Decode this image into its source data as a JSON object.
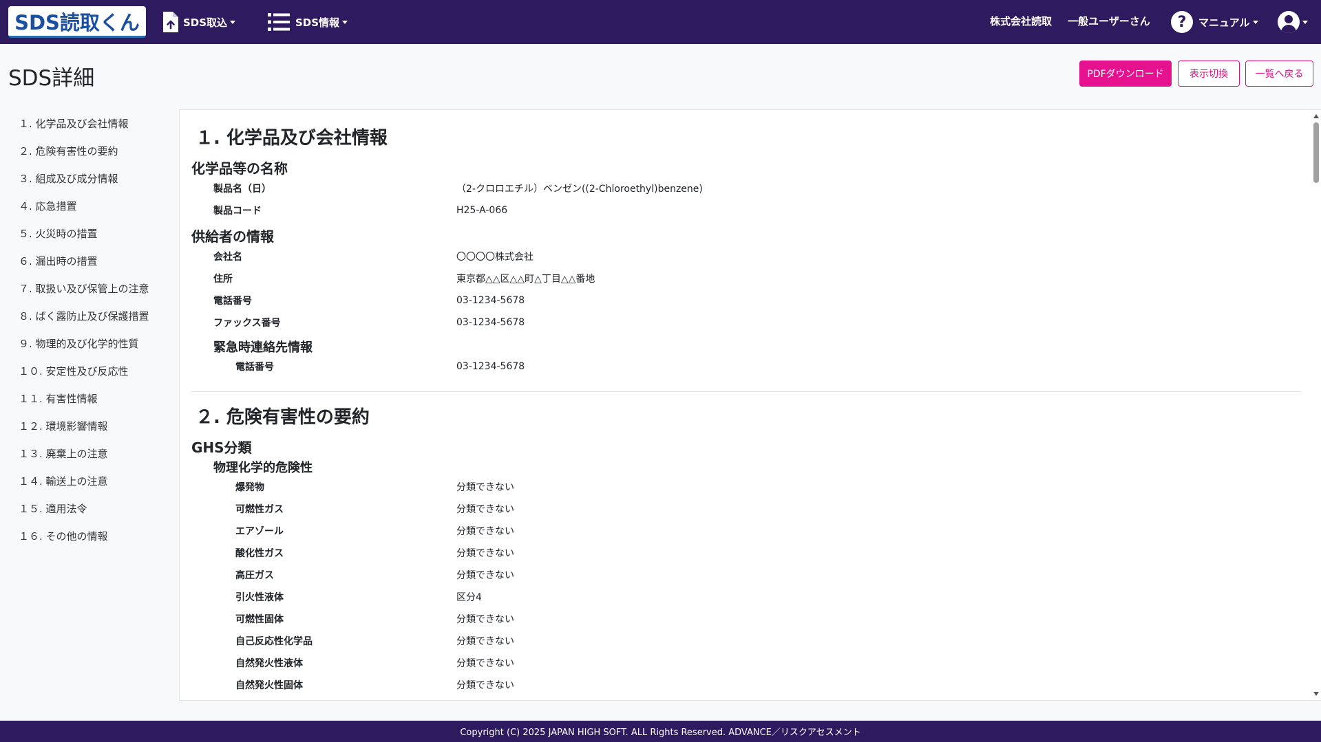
{
  "navbar": {
    "brand": "SDS読取くん",
    "upload_label": "SDS取込",
    "info_label": "SDS情報",
    "company": "株式会社読取",
    "user": "一般ユーザーさん",
    "manual_label": "マニュアル",
    "help_glyph": "?"
  },
  "header": {
    "title": "SDS詳細",
    "pdf_button": "PDFダウンロード",
    "toggle_button": "表示切換",
    "back_button": "一覧へ戻る"
  },
  "sidebar": {
    "items": [
      {
        "label": "１. 化学品及び会社情報"
      },
      {
        "label": "２. 危険有害性の要約"
      },
      {
        "label": "３. 組成及び成分情報"
      },
      {
        "label": "４. 応急措置"
      },
      {
        "label": "５. 火災時の措置"
      },
      {
        "label": "６. 漏出時の措置"
      },
      {
        "label": "７. 取扱い及び保管上の注意"
      },
      {
        "label": "８. ばく露防止及び保護措置"
      },
      {
        "label": "９. 物理的及び化学的性質"
      },
      {
        "label": "１０. 安定性及び反応性"
      },
      {
        "label": "１１. 有害性情報"
      },
      {
        "label": "１２. 環境影響情報"
      },
      {
        "label": "１３. 廃棄上の注意"
      },
      {
        "label": "１４. 輸送上の注意"
      },
      {
        "label": "１５. 適用法令"
      },
      {
        "label": "１６. その他の情報"
      }
    ]
  },
  "section1": {
    "title": "１. 化学品及び会社情報",
    "product_heading": "化学品等の名称",
    "product_name_label": "製品名（日）",
    "product_name_value": "（2-クロロエチル）ベンゼン((2-Chloroethyl)benzene)",
    "product_code_label": "製品コード",
    "product_code_value": "H25-A-066",
    "supplier_heading": "供給者の情報",
    "company_label": "会社名",
    "company_value": "〇〇〇〇株式会社",
    "address_label": "住所",
    "address_value": "東京都△△区△△町△丁目△△番地",
    "phone_label": "電話番号",
    "phone_value": "03-1234-5678",
    "fax_label": "ファックス番号",
    "fax_value": "03-1234-5678",
    "emergency_heading": "緊急時連絡先情報",
    "emergency_phone_label": "電話番号",
    "emergency_phone_value": "03-1234-5678"
  },
  "section2": {
    "title": "２. 危険有害性の要約",
    "ghs_heading": "GHS分類",
    "physchem_heading": "物理化学的危険性",
    "hazards": [
      {
        "label": "爆発物",
        "value": "分類できない"
      },
      {
        "label": "可燃性ガス",
        "value": "分類できない"
      },
      {
        "label": "エアゾール",
        "value": "分類できない"
      },
      {
        "label": "酸化性ガス",
        "value": "分類できない"
      },
      {
        "label": "高圧ガス",
        "value": "分類できない"
      },
      {
        "label": "引火性液体",
        "value": "区分4"
      },
      {
        "label": "可燃性固体",
        "value": "分類できない"
      },
      {
        "label": "自己反応性化学品",
        "value": "分類できない"
      },
      {
        "label": "自然発火性液体",
        "value": "分類できない"
      },
      {
        "label": "自然発火性固体",
        "value": "分類できない"
      }
    ]
  },
  "footer": {
    "copyright": "Copyright (C) 2025 JAPAN HIGH SOFT. ALL Rights Reserved. ADVANCE／リスクアセスメント"
  }
}
